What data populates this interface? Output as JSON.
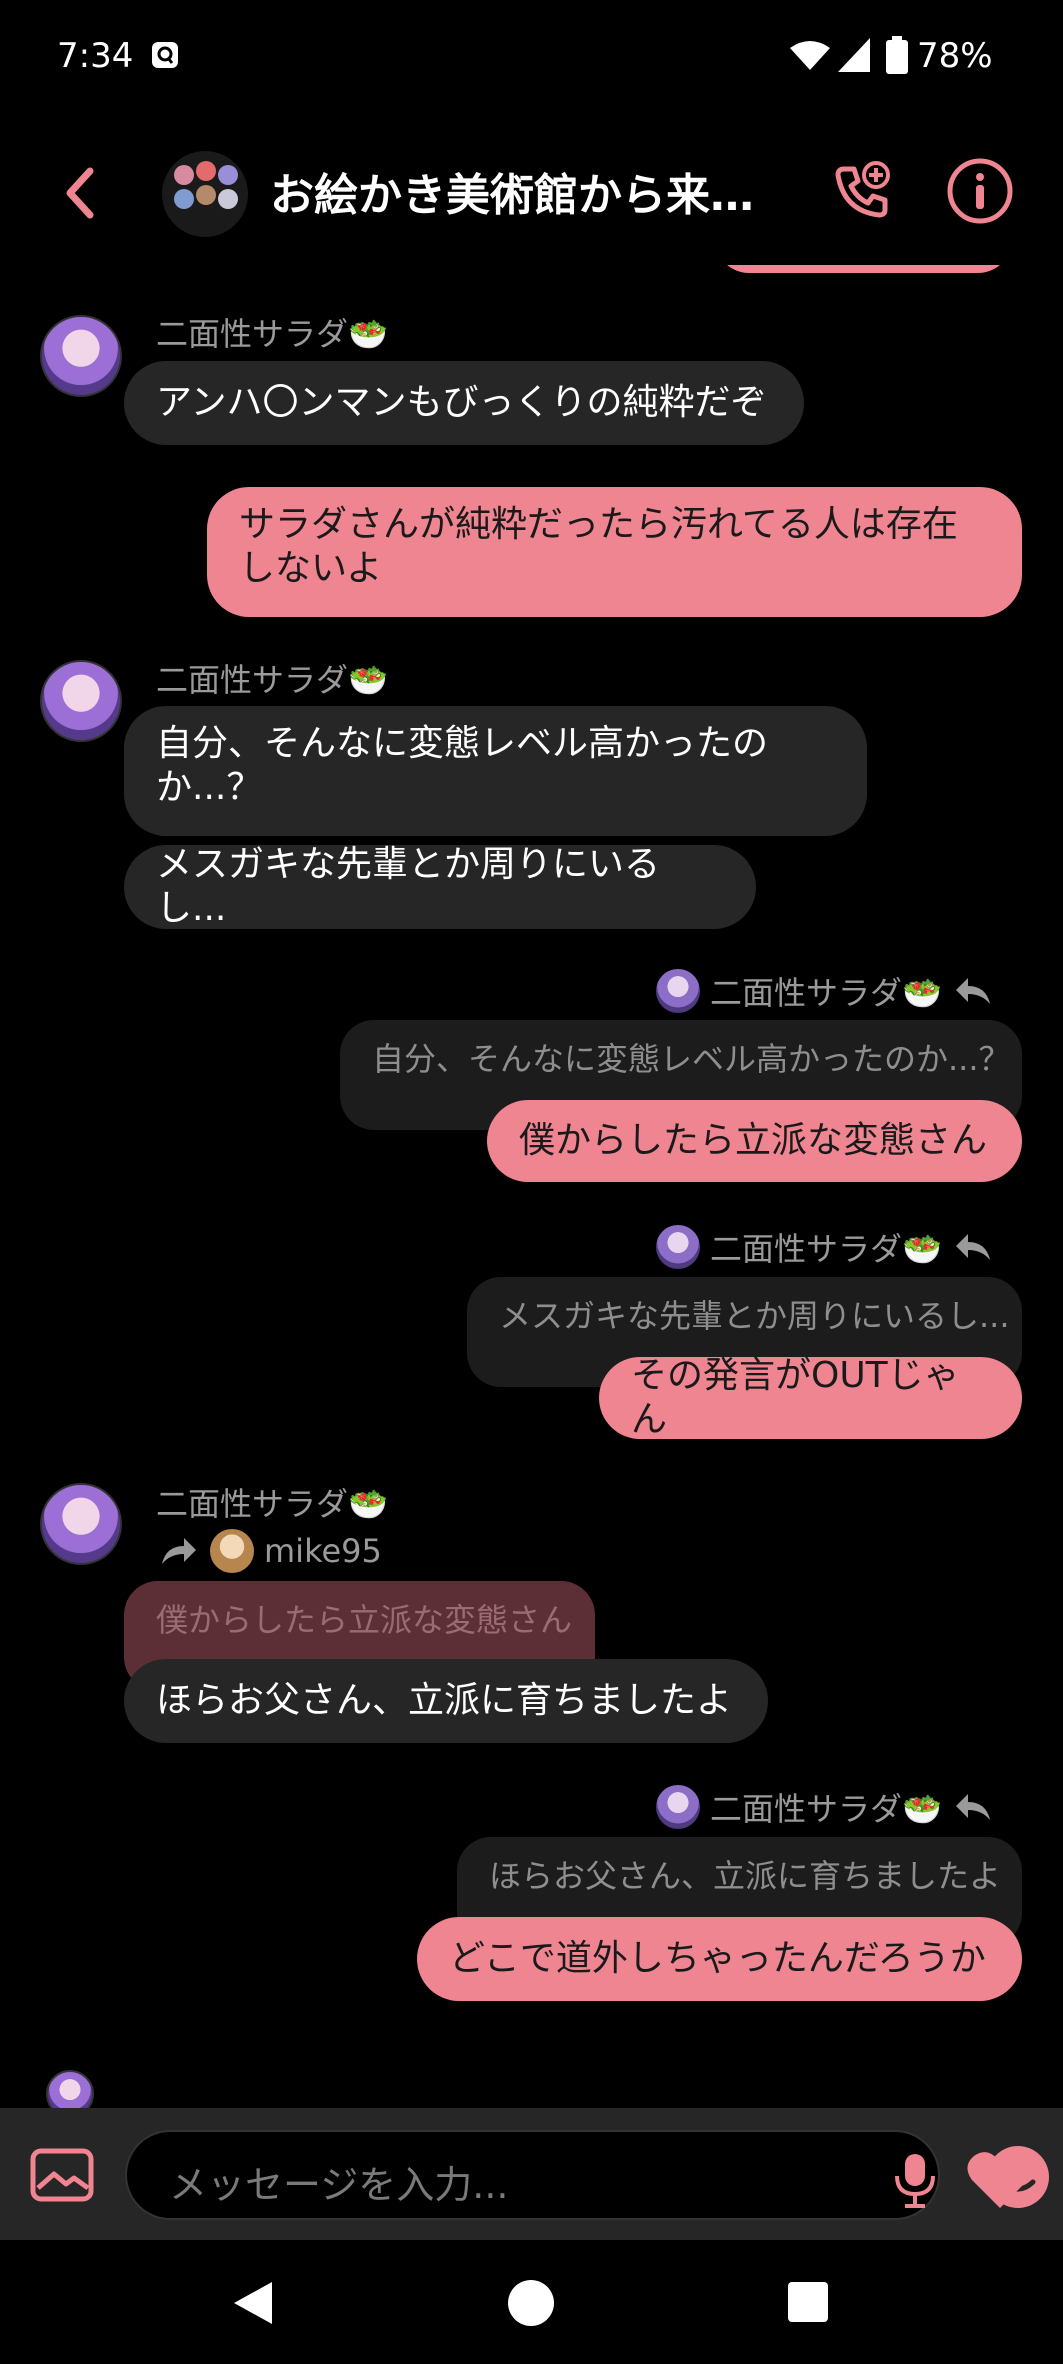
{
  "status_bar": {
    "time": "7:34",
    "battery": "78%"
  },
  "header": {
    "title": "お絵かき美術館から来た..."
  },
  "messages": {
    "m1_sender": "二面性サラダ🥗",
    "m1_text": "アンハ〇ンマンもびっくりの純粋だぞ",
    "m2_text": "サラダさんが純粋だったら汚れてる人は存在しないよ",
    "m3_sender": "二面性サラダ🥗",
    "m3_text_a": "自分、そんなに変態レベル高かったのか...？",
    "m3_text_b": "メスガキな先輩とか周りにいるし...",
    "r1_reply_to": "二面性サラダ🥗",
    "r1_quote": "自分、そんなに変態レベル高かったのか...？",
    "r1_text": "僕からしたら立派な変態さん",
    "r2_reply_to": "二面性サラダ🥗",
    "r2_quote": "メスガキな先輩とか周りにいるし...",
    "r2_text": "その発言がOUTじゃん",
    "m4_sender": "二面性サラダ🥗",
    "m4_reply_to": "mike95",
    "m4_quote": "僕からしたら立派な変態さん",
    "m4_text": "ほらお父さん、立派に育ちましたよ",
    "r3_reply_to": "二面性サラダ🥗",
    "r3_quote": "ほらお父さん、立派に育ちましたよ",
    "r3_text": "どこで道外しちゃったんだろうか"
  },
  "input": {
    "placeholder": "メッセージを入力..."
  },
  "colors": {
    "accent": "#ef8591",
    "incoming_bubble": "#262626",
    "background": "#000000"
  }
}
